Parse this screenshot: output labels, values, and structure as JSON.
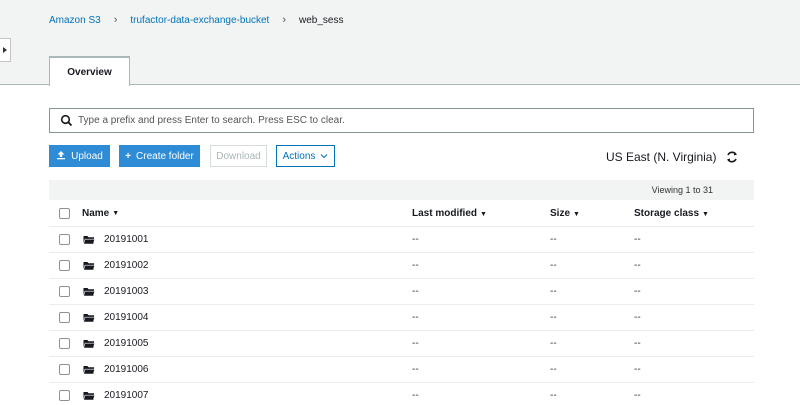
{
  "breadcrumb": {
    "items": [
      "Amazon S3",
      "trufactor-data-exchange-bucket"
    ],
    "current": "web_sess",
    "separator": "›"
  },
  "tabs": [
    {
      "label": "Overview",
      "active": true
    }
  ],
  "search": {
    "placeholder": "Type a prefix and press Enter to search. Press ESC to clear.",
    "value": ""
  },
  "toolbar": {
    "upload_label": "Upload",
    "create_folder_label": "Create folder",
    "download_label": "Download",
    "actions_label": "Actions"
  },
  "region": "US East (N. Virginia)",
  "viewing": "Viewing 1 to 31",
  "table": {
    "headers": [
      "Name",
      "Last modified",
      "Size",
      "Storage class"
    ],
    "rows": [
      {
        "name": "20191001",
        "modified": "--",
        "size": "--",
        "class": "--"
      },
      {
        "name": "20191002",
        "modified": "--",
        "size": "--",
        "class": "--"
      },
      {
        "name": "20191003",
        "modified": "--",
        "size": "--",
        "class": "--"
      },
      {
        "name": "20191004",
        "modified": "--",
        "size": "--",
        "class": "--"
      },
      {
        "name": "20191005",
        "modified": "--",
        "size": "--",
        "class": "--"
      },
      {
        "name": "20191006",
        "modified": "--",
        "size": "--",
        "class": "--"
      },
      {
        "name": "20191007",
        "modified": "--",
        "size": "--",
        "class": "--"
      }
    ]
  },
  "colors": {
    "link": "#0073bb",
    "primary": "#2e8bd6",
    "header_bg": "#f2f3f3"
  }
}
